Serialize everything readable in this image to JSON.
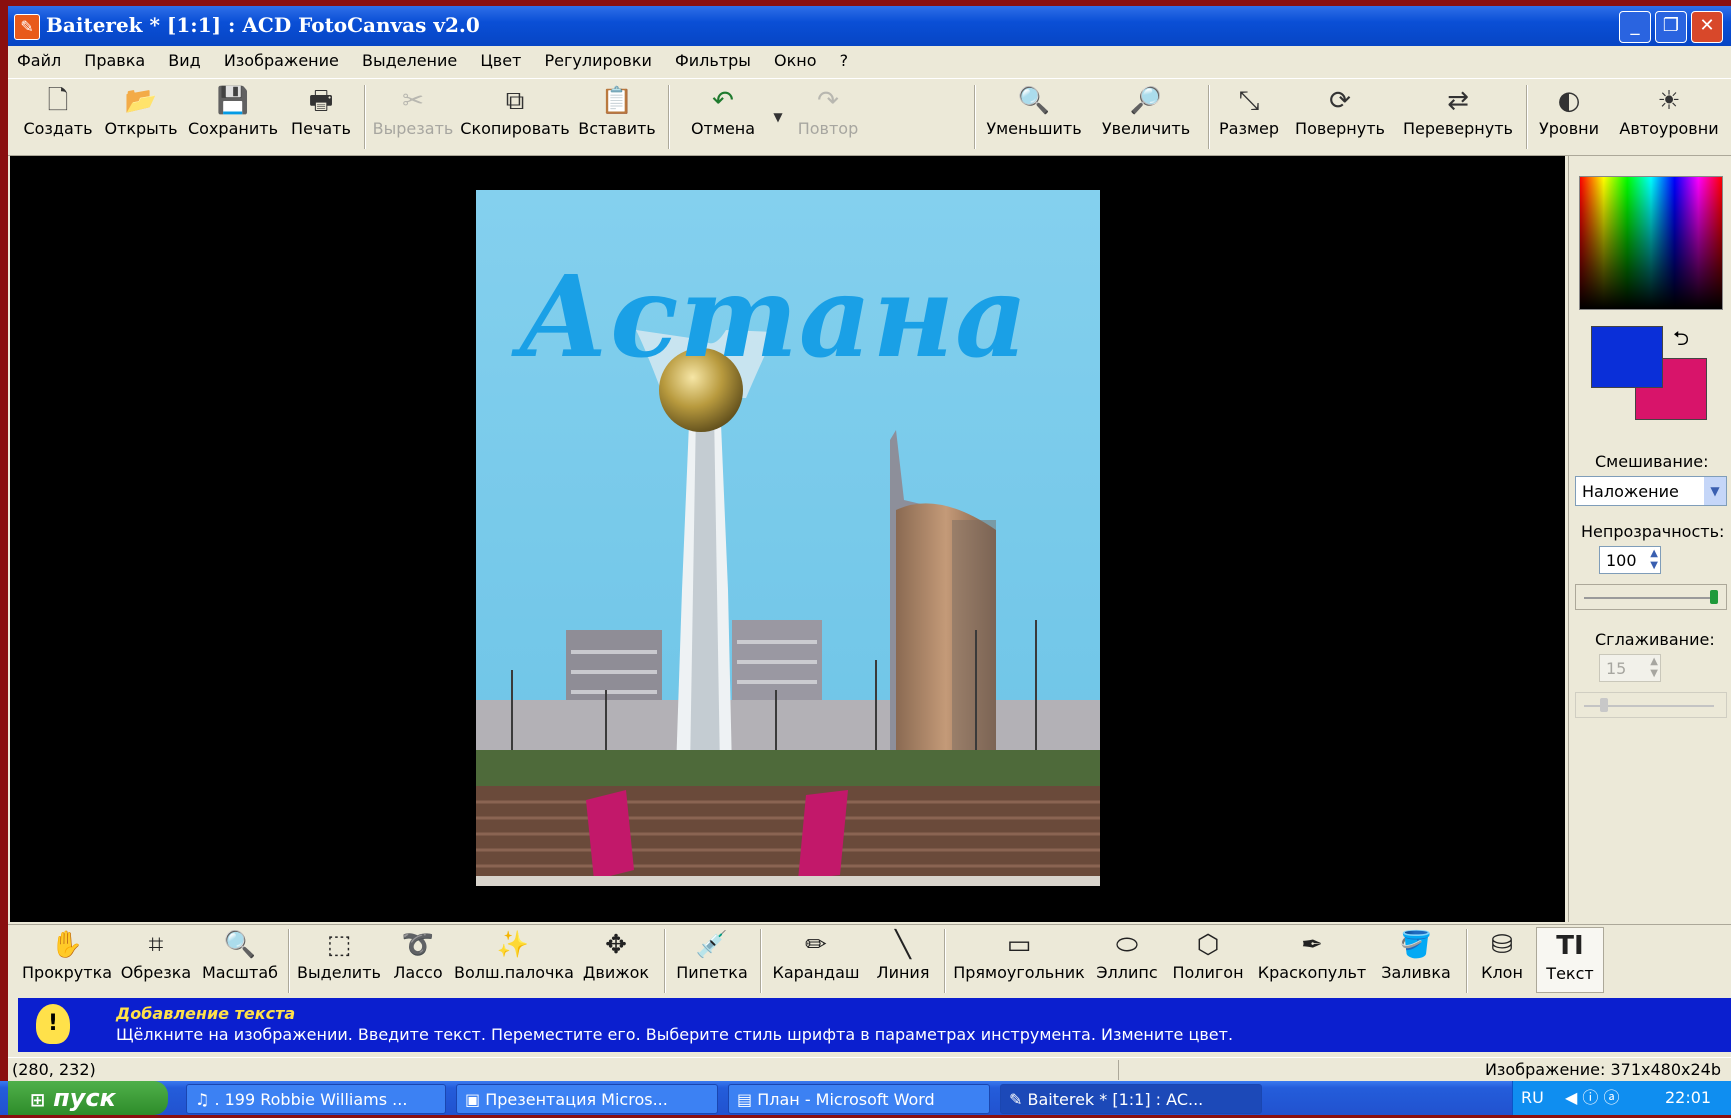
{
  "window": {
    "title": "Baiterek * [1:1] : ACD FotoCanvas v2.0",
    "minimize_symbol": "_",
    "maximize_symbol": "❐",
    "close_symbol": "✕"
  },
  "menu": [
    "Файл",
    "Правка",
    "Вид",
    "Изображение",
    "Выделение",
    "Цвет",
    "Регулировки",
    "Фильтры",
    "Окно",
    "?"
  ],
  "toolbar": {
    "create": "Создать",
    "open": "Открыть",
    "save": "Сохранить",
    "print": "Печать",
    "cut": "Вырезать",
    "copy": "Скопировать",
    "paste": "Вставить",
    "undo": "Отмена",
    "redo": "Повтор",
    "zoom_out": "Уменьшить",
    "zoom_in": "Увеличить",
    "resize": "Размер",
    "rotate": "Повернуть",
    "flip": "Перевернуть",
    "levels": "Уровни",
    "auto_levels": "Автоуровни"
  },
  "image": {
    "caption_text": "Астана"
  },
  "side_panel": {
    "blend_label": "Смешивание:",
    "blend_value": "Наложение",
    "opacity_label": "Непрозрачность:",
    "opacity_value": "100",
    "opacity_level": 1.0,
    "smoothing_label": "Сглаживание:",
    "smoothing_value": "15",
    "smoothing_level": 0.15,
    "foreground_color": "#0a2fd8",
    "background_color": "#d8146a"
  },
  "tools": {
    "scroll": "Прокрутка",
    "crop": "Обрезка",
    "zoom": "Масштаб",
    "select": "Выделить",
    "lasso": "Лассо",
    "magic_wand": "Волш.палочка",
    "move": "Движок",
    "eyedropper": "Пипетка",
    "pencil": "Карандаш",
    "line": "Линия",
    "rectangle": "Прямоугольник",
    "ellipse": "Эллипс",
    "polygon": "Полигон",
    "airbrush": "Краскопульт",
    "fill": "Заливка",
    "clone": "Клон",
    "text": "Текст"
  },
  "hint": {
    "title": "Добавление текста",
    "text": "Щёлкните на изображении.  Введите текст.  Переместите его.  Выберите стиль шрифта в параметрах инструмента.  Измените цвет."
  },
  "status": {
    "coords": "(280, 232)",
    "image_info": "Изображение: 371x480x24b"
  },
  "taskbar": {
    "start": "пуск",
    "tasks": [
      ". 199 Robbie Williams ...",
      "Презентация Micros...",
      "План - Microsoft Word",
      "Baiterek * [1:1] : AC..."
    ],
    "lang": "RU",
    "time": "22:01"
  }
}
